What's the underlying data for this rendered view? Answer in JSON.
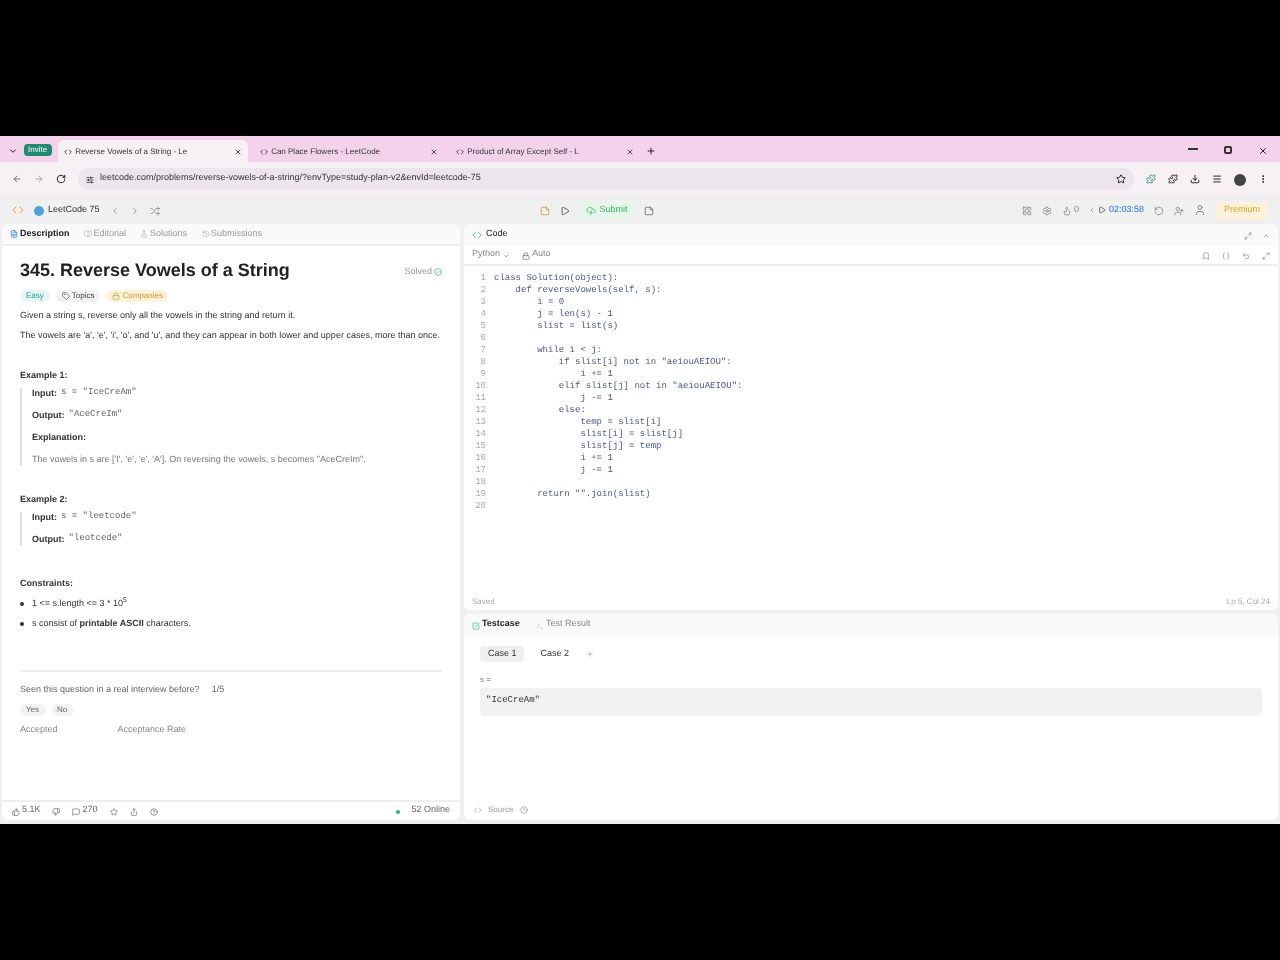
{
  "browser": {
    "profile_badge": "Invite",
    "tabs": [
      {
        "title": "Reverse Vowels of a String - Le",
        "selected": true
      },
      {
        "title": "Can Place Flowers - LeetCode",
        "selected": false
      },
      {
        "title": "Product of Array Except Self - L",
        "selected": false
      }
    ],
    "url": "leetcode.com/problems/reverse-vowels-of-a-string/?envType=study-plan-v2&envId=leetcode-75"
  },
  "navbar": {
    "study_plan": "LeetCode 75",
    "submit": "Submit",
    "timer": "02:03:58",
    "premium": "Premium",
    "notes_count": "0"
  },
  "description_tabs": [
    {
      "label": "Description",
      "selected": true
    },
    {
      "label": "Editorial",
      "selected": false
    },
    {
      "label": "Solutions",
      "selected": false
    },
    {
      "label": "Submissions",
      "selected": false
    }
  ],
  "problem": {
    "title": "345. Reverse Vowels of a String",
    "status": "Solved",
    "tags": [
      {
        "label": "Easy",
        "kind": "difficulty"
      },
      {
        "label": "Topics",
        "kind": "topics"
      },
      {
        "label": "Companies",
        "kind": "companies"
      }
    ],
    "paragraphs": [
      "Given a string s, reverse only all the vowels in the string and return it.",
      "The vowels are 'a', 'e', 'i', 'o', and 'u', and they can appear in both lower and upper cases, more than once."
    ],
    "examples": [
      {
        "heading": "Example 1:",
        "input_label": "Input:",
        "input": "s = \"IceCreAm\"",
        "output_label": "Output:",
        "output": "\"AceCreIm\"",
        "explanation_label": "Explanation:",
        "explanation": "The vowels in s are ['I', 'e', 'e', 'A']. On reversing the vowels, s becomes \"AceCreIm\"."
      },
      {
        "heading": "Example 2:",
        "input_label": "Input:",
        "input": "s = \"leetcode\"",
        "output_label": "Output:",
        "output": "\"leotcede\""
      }
    ],
    "constraints_heading": "Constraints:",
    "constraints": [
      "1 <= s.length <= 3 * 10$^{5}$",
      "s consist of **printable ASCII** characters."
    ],
    "interview_question": "Seen this question in a real interview before?",
    "interview_count": "1/5",
    "answers": [
      "Yes",
      "No"
    ],
    "stats": [
      "Accepted",
      "Acceptance Rate"
    ],
    "likes": "5.1K",
    "comments": "270",
    "online": "52 Online"
  },
  "code": {
    "title": "Code",
    "language": "Python",
    "mode": "Auto",
    "lines": [
      {
        "number": "1",
        "text": "class Solution(object):"
      },
      {
        "number": "2",
        "text": "    def reverseVowels(self, s):"
      },
      {
        "number": "3",
        "text": "        i = 0"
      },
      {
        "number": "4",
        "text": "        j = len(s) - 1"
      },
      {
        "number": "5",
        "text": "        slist = list(s)"
      },
      {
        "number": "6"
      },
      {
        "number": "7",
        "text": "        while i < j:"
      },
      {
        "number": "8",
        "text": "            if slist[i] not in \"aeiouAEIOU\":"
      },
      {
        "number": "9",
        "text": "                i += 1"
      },
      {
        "number": "10",
        "text": "            elif slist[j] not in \"aeiouAEIOU\":"
      },
      {
        "number": "11",
        "text": "                j -= 1"
      },
      {
        "number": "12",
        "text": "            else:"
      },
      {
        "number": "13",
        "text": "                temp = slist[i]"
      },
      {
        "number": "14",
        "text": "                slist[i] = slist[j]"
      },
      {
        "number": "15",
        "text": "                slist[j] = temp"
      },
      {
        "number": "16",
        "text": "                i += 1"
      },
      {
        "number": "17",
        "text": "                j -= 1"
      },
      {
        "number": "18"
      },
      {
        "number": "19",
        "text": "        return \"\".join(slist)"
      },
      {
        "number": "20"
      }
    ],
    "saved": "Saved",
    "cursor": "Ln 5, Col 24"
  },
  "testcase": {
    "tabs": [
      {
        "label": "Testcase",
        "selected": true
      },
      {
        "label": "Test Result",
        "selected": false
      }
    ],
    "cases": [
      {
        "label": "Case 1",
        "selected": true
      },
      {
        "label": "Case 2",
        "selected": false
      }
    ],
    "var_label": "s =",
    "value": "\"IceCreAm\"",
    "source": "Source"
  }
}
